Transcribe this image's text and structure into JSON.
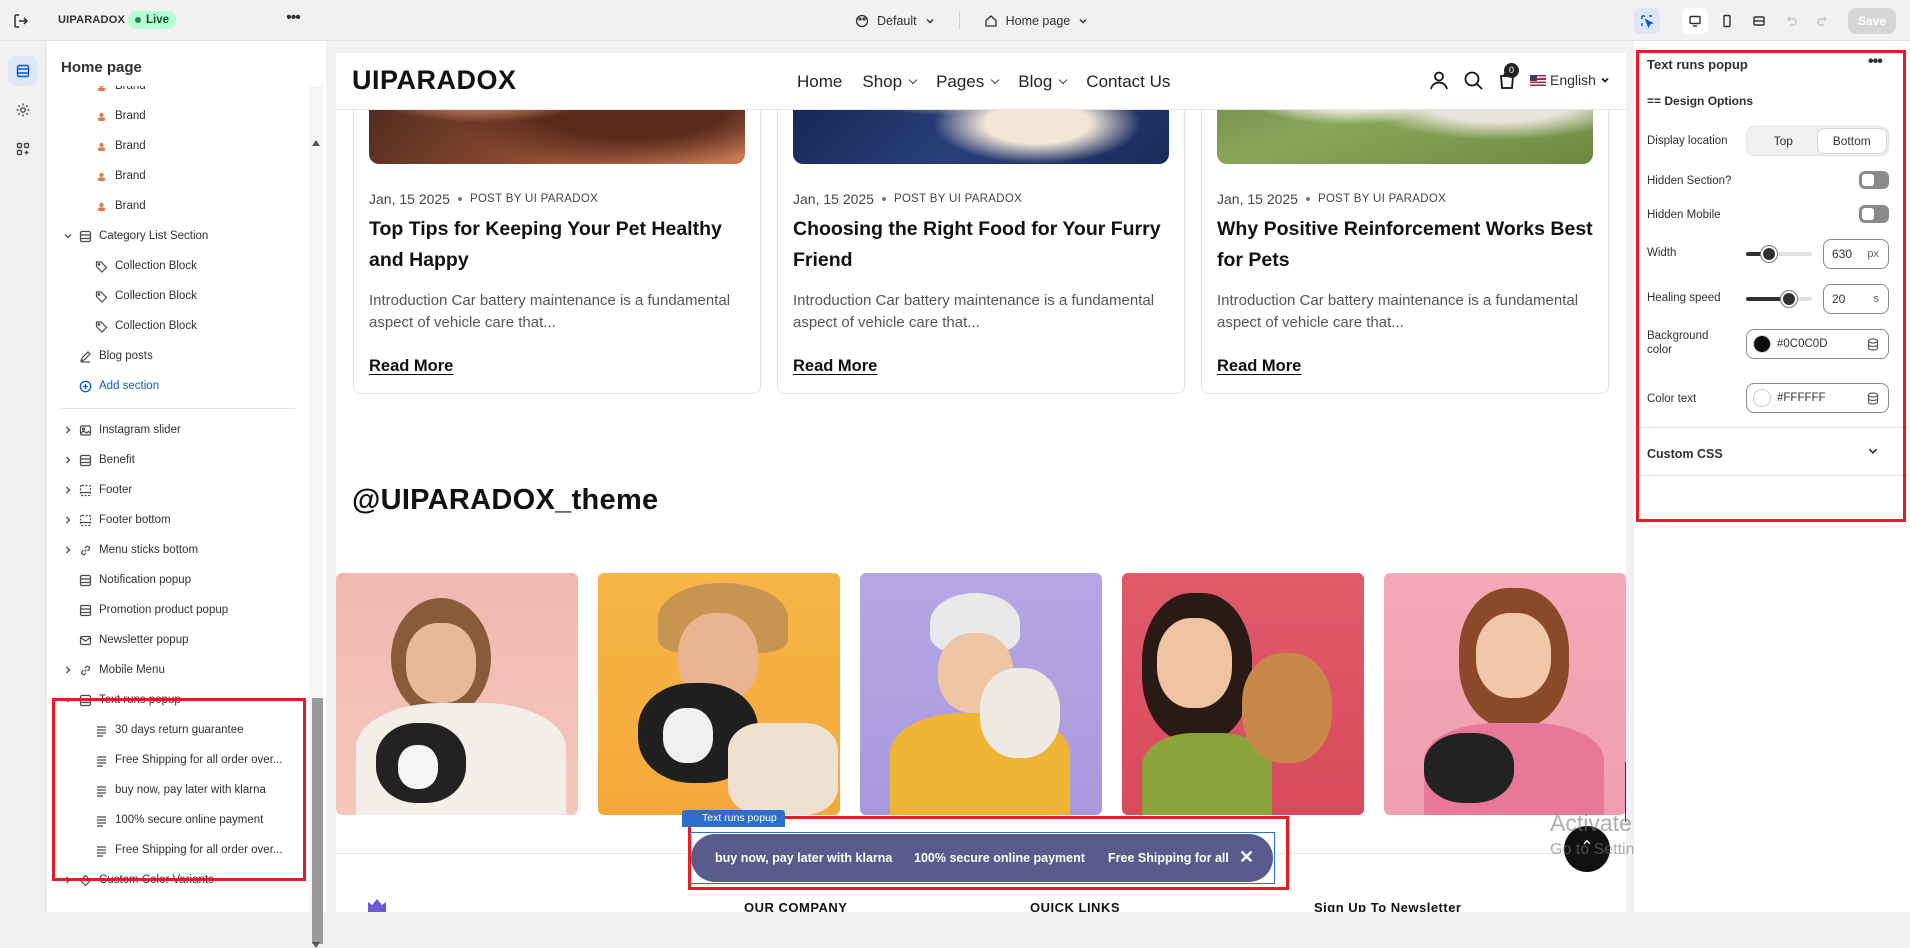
{
  "topbar": {
    "store_name": "UIPARADOX",
    "status": "Live",
    "theme": "Default",
    "page": "Home page",
    "save_label": "Save"
  },
  "sidebar": {
    "title": "Home page",
    "items": [
      {
        "label": "Brand",
        "level": 2,
        "icon": "brand-thumb-icon"
      },
      {
        "label": "Brand",
        "level": 2,
        "icon": "brand-thumb-icon"
      },
      {
        "label": "Brand",
        "level": 2,
        "icon": "brand-thumb-icon"
      },
      {
        "label": "Brand",
        "level": 2,
        "icon": "brand-thumb-icon"
      },
      {
        "label": "Brand",
        "level": 2,
        "icon": "brand-thumb-icon"
      },
      {
        "label": "Category List Section",
        "level": 1,
        "icon": "section-icon",
        "caret": "down"
      },
      {
        "label": "Collection Block",
        "level": 2,
        "icon": "tag-icon"
      },
      {
        "label": "Collection Block",
        "level": 2,
        "icon": "tag-icon"
      },
      {
        "label": "Collection Block",
        "level": 2,
        "icon": "tag-icon"
      },
      {
        "label": "Blog posts",
        "level": 1,
        "icon": "edit-icon"
      },
      {
        "label": "Add section",
        "level": 1,
        "icon": "add-circle-icon",
        "accent": true
      },
      {
        "label": "Instagram slider",
        "level": 1,
        "icon": "image-icon",
        "caret": "right"
      },
      {
        "label": "Benefit",
        "level": 1,
        "icon": "section-icon",
        "caret": "right"
      },
      {
        "label": "Footer",
        "level": 1,
        "icon": "footer-icon",
        "caret": "right"
      },
      {
        "label": "Footer bottom",
        "level": 1,
        "icon": "footer-icon",
        "caret": "right"
      },
      {
        "label": "Menu sticks bottom",
        "level": 1,
        "icon": "link-icon",
        "caret": "right"
      },
      {
        "label": "Notification popup",
        "level": 1,
        "icon": "section-icon"
      },
      {
        "label": "Promotion product popup",
        "level": 1,
        "icon": "section-icon"
      },
      {
        "label": "Newsletter popup",
        "level": 1,
        "icon": "email-icon"
      },
      {
        "label": "Mobile Menu",
        "level": 1,
        "icon": "link-icon",
        "caret": "right"
      },
      {
        "label": "Text runs popup",
        "level": 1,
        "icon": "section-icon",
        "caret": "down",
        "selected": true
      },
      {
        "label": "30 days return guarantee",
        "level": 2,
        "icon": "text-icon"
      },
      {
        "label": "Free Shipping for all order over...",
        "level": 2,
        "icon": "text-icon"
      },
      {
        "label": "buy now, pay later with klarna",
        "level": 2,
        "icon": "text-icon"
      },
      {
        "label": "100% secure online payment",
        "level": 2,
        "icon": "text-icon"
      },
      {
        "label": "Free Shipping for all order over...",
        "level": 2,
        "icon": "text-icon"
      },
      {
        "label": "Custom Color Variants",
        "level": 1,
        "icon": "paint-icon",
        "caret": "right"
      }
    ]
  },
  "site": {
    "logo": "UIPARADOX",
    "nav": [
      "Home",
      "Shop",
      "Pages",
      "Blog",
      "Contact Us"
    ],
    "cart_count": "0",
    "language": "English",
    "posts": [
      {
        "date": "Jan, 15 2025",
        "author": "POST BY UI PARADOX",
        "title": "Top Tips for Keeping Your Pet Healthy and Happy",
        "excerpt": "Introduction Car battery maintenance is a fundamental aspect of vehicle care that...",
        "cta": "Read More"
      },
      {
        "date": "Jan, 15 2025",
        "author": "POST BY UI PARADOX",
        "title": "Choosing the Right Food for Your Furry Friend",
        "excerpt": "Introduction Car battery maintenance is a fundamental aspect of vehicle care that...",
        "cta": "Read More"
      },
      {
        "date": "Jan, 15 2025",
        "author": "POST BY UI PARADOX",
        "title": "Why Positive Reinforcement Works Best for Pets",
        "excerpt": "Introduction Car battery maintenance is a fundamental aspect of vehicle care that...",
        "cta": "Read More"
      }
    ],
    "instagram_handle": "@UIPARADOX_theme",
    "footer_headings": [
      "OUR COMPANY",
      "QUICK LINKS",
      "Sign Up To Newsletter"
    ],
    "popup_tag": "Text runs popup",
    "marquee": [
      "buy now, pay later with klarna",
      "100% secure online payment",
      "Free Shipping for all or"
    ],
    "close_glyph": "✕",
    "back_to_top_glyph": "⌃"
  },
  "watermark": {
    "line1": "Activate Windows",
    "line2": "Go to Settings to activate Windows."
  },
  "settings": {
    "title": "Text runs popup",
    "subtitle": "== Design Options",
    "display_location_label": "Display location",
    "display_location_options": [
      "Top",
      "Bottom"
    ],
    "display_location_selected": "Bottom",
    "hidden_section_label": "Hidden Section?",
    "hidden_section": false,
    "hidden_mobile_label": "Hidden Mobile",
    "hidden_mobile": false,
    "width_label": "Width",
    "width_value": "630",
    "width_unit": "px",
    "width_slider_fraction": 0.35,
    "healing_label": "Healing speed",
    "healing_value": "20",
    "healing_unit": "s",
    "healing_slider_fraction": 0.65,
    "bg_label": "Background color",
    "bg_value": "#0C0C0D",
    "text_label": "Color text",
    "text_value": "#FFFFFF",
    "custom_css_label": "Custom CSS"
  },
  "colors": {
    "accent": "#005bd3",
    "highlight": "#e51c23",
    "live_badge": "#b4fed2",
    "marquee_bg": "#5a5a8c"
  }
}
